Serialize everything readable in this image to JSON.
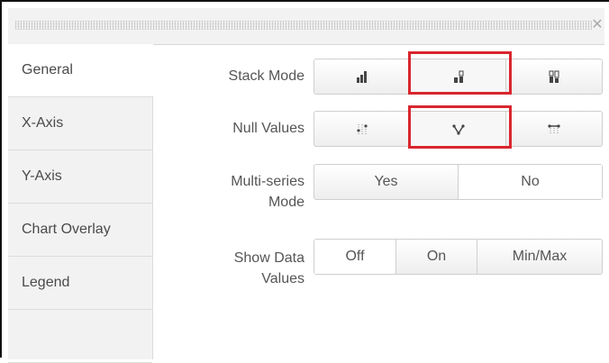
{
  "dialog": {
    "close_glyph": "✕"
  },
  "sidebar": {
    "items": [
      {
        "label": "General",
        "active": true
      },
      {
        "label": "X-Axis"
      },
      {
        "label": "Y-Axis"
      },
      {
        "label": "Chart Overlay"
      },
      {
        "label": "Legend"
      }
    ]
  },
  "settings": {
    "stack_mode": {
      "label": "Stack Mode",
      "options": [
        {
          "icon": "unstacked-bars-icon"
        },
        {
          "icon": "stacked-bars-icon",
          "selected": true
        },
        {
          "icon": "stacked-100-bars-icon"
        }
      ]
    },
    "null_values": {
      "label": "Null Values",
      "options": [
        {
          "icon": "gaps-icon"
        },
        {
          "icon": "zero-icon",
          "selected": true
        },
        {
          "icon": "connect-icon"
        }
      ]
    },
    "multi_series": {
      "label_line1": "Multi-series",
      "label_line2": "Mode",
      "options": [
        {
          "label": "Yes"
        },
        {
          "label": "No",
          "selected": true
        }
      ]
    },
    "show_data_values": {
      "label_line1": "Show Data",
      "label_line2": "Values",
      "options": [
        {
          "label": "Off",
          "selected": true
        },
        {
          "label": "On"
        },
        {
          "label": "Min/Max"
        }
      ]
    }
  },
  "colors": {
    "highlight": "#d9262e",
    "icon": "#444444",
    "sidebar_bg": "#f2f2f2"
  }
}
